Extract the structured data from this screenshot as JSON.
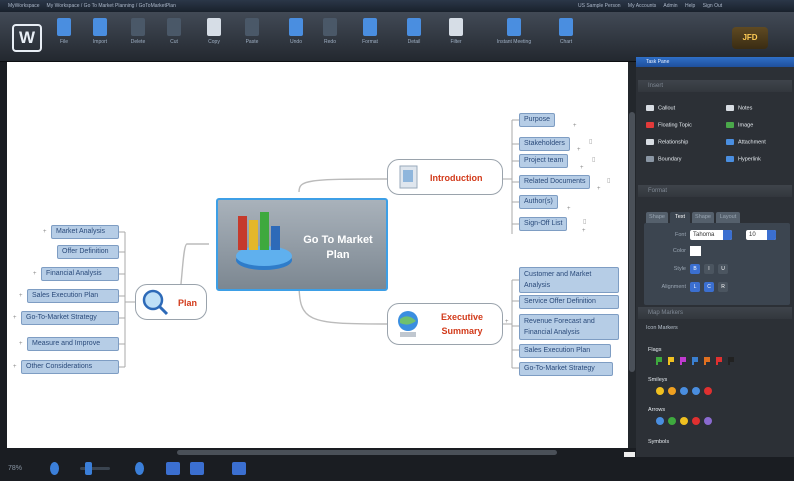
{
  "window": {
    "title": "MyWorkspace",
    "doc_path": "My Workspace / Go To Market Planning / GoToMarketPlan",
    "user_links": [
      "US Sample Person",
      "My Accounts",
      "Admin",
      "Help",
      "Sign Out"
    ]
  },
  "toolbar": {
    "logo_letter": "W",
    "buttons": [
      {
        "label": "File",
        "icon": "folder-icon",
        "color": "#4a8ee0"
      },
      {
        "label": "Import",
        "icon": "import-icon",
        "color": "#4a8ee0"
      },
      {
        "label": "Delete",
        "icon": "delete-icon",
        "color": "#4a5868"
      },
      {
        "label": "Cut",
        "icon": "cut-icon",
        "color": "#4a5868"
      },
      {
        "label": "Copy",
        "icon": "copy-icon",
        "color": "#d6dde6"
      },
      {
        "label": "Paste",
        "icon": "paste-icon",
        "color": "#4a5868"
      },
      {
        "label": "Undo",
        "icon": "undo-icon",
        "color": "#4a8ee0"
      },
      {
        "label": "Redo",
        "icon": "redo-icon",
        "color": "#4a5868"
      },
      {
        "label": "Format",
        "icon": "pencil-icon",
        "color": "#4a8ee0"
      },
      {
        "label": "Detail",
        "icon": "detail-icon",
        "color": "#4a8ee0"
      },
      {
        "label": "Filter",
        "icon": "filter-icon",
        "color": "#d6dde6"
      },
      {
        "label": "Instant Meeting",
        "icon": "meeting-icon",
        "color": "#4a8ee0"
      },
      {
        "label": "Chart",
        "icon": "chart-icon",
        "color": "#4a8ee0"
      }
    ],
    "user_badge": "JFD"
  },
  "map": {
    "central": "Go To Market Plan",
    "introduction": {
      "label": "Introduction",
      "children": [
        "Purpose",
        "Stakeholders",
        "Project team",
        "Related Documents",
        "Author(s)",
        "Sign-Off List"
      ]
    },
    "executive_summary": {
      "label": "Executive Summary",
      "children": [
        "Customer and Market Analysis",
        "Service Offer Definition",
        "Revenue Forecast and Financial Analysis",
        "Sales Execution Plan",
        "Go-To-Market Strategy"
      ]
    },
    "plan": {
      "label": "Plan",
      "children": [
        "Market Analysis",
        "Offer Definition",
        "Financial Analysis",
        "Sales Execution Plan",
        "Go-To-Market Strategy",
        "Measure and Improve",
        "Other Considerations"
      ]
    }
  },
  "taskpane": {
    "header": "Task Pane",
    "insert": {
      "title": "Insert",
      "items": [
        {
          "label": "Callout",
          "icon": "callout-icon",
          "color": "#d8dde3"
        },
        {
          "label": "Notes",
          "icon": "notes-icon",
          "color": "#d8dde3"
        },
        {
          "label": "Floating Topic",
          "icon": "floating-topic-icon",
          "color": "#e23a3a"
        },
        {
          "label": "Image",
          "icon": "image-icon",
          "color": "#4aa84a"
        },
        {
          "label": "Relationship",
          "icon": "relationship-icon",
          "color": "#d8dde3"
        },
        {
          "label": "Attachment",
          "icon": "attachment-icon",
          "color": "#4a8ee0"
        },
        {
          "label": "Boundary",
          "icon": "boundary-icon",
          "color": "#8a96a4"
        },
        {
          "label": "Hyperlink",
          "icon": "hyperlink-icon",
          "color": "#4a8ee0"
        }
      ]
    },
    "format": {
      "title": "Format",
      "tabs": [
        "Shape",
        "Text",
        "Shape",
        "Layout"
      ],
      "active_tab": 1,
      "font_label": "Font",
      "font_value": "Tahoma",
      "size_value": "10",
      "color_label": "Color",
      "style_label": "Style",
      "style_buttons": [
        "B",
        "I",
        "U"
      ],
      "alignment_label": "Alignment",
      "align_buttons": [
        "L",
        "C",
        "R"
      ]
    },
    "markers": {
      "title": "Map Markers",
      "subtitle": "Icon Markers",
      "groups": [
        {
          "name": "Flags",
          "colors": [
            "#3ea93e",
            "#f0c020",
            "#c03ad0",
            "#3a7fd0",
            "#e07020",
            "#e03030",
            "#222222"
          ]
        },
        {
          "name": "Smileys",
          "colors": [
            "#f0c020",
            "#f0a020",
            "#4a8ee0",
            "#4a8ee0",
            "#e03030"
          ]
        },
        {
          "name": "Arrows",
          "colors": [
            "#4a8ee0",
            "#3ea93e",
            "#f0c020",
            "#e03030",
            "#8a6ad0"
          ]
        },
        {
          "name": "Symbols",
          "colors": []
        }
      ]
    }
  },
  "status": {
    "zoom": "78%"
  }
}
